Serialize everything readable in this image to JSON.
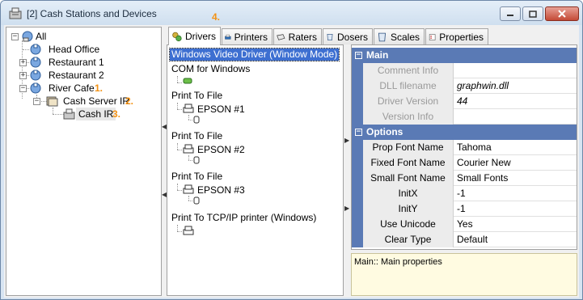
{
  "window": {
    "title": "[2] Cash Stations and Devices"
  },
  "annotations": [
    "1.",
    "2.",
    "3.",
    "4."
  ],
  "tree": {
    "root": "All",
    "items": [
      "Head Office",
      "Restaurant 1",
      "Restaurant 2",
      "River Cafe"
    ],
    "server": "Cash Server IR",
    "station": "Cash IR"
  },
  "tabs": [
    {
      "label": "Drivers",
      "icon": "drivers-icon"
    },
    {
      "label": "Printers",
      "icon": "printer-icon"
    },
    {
      "label": "Raters",
      "icon": "scale-icon"
    },
    {
      "label": "Dosers",
      "icon": "doser-icon"
    },
    {
      "label": "Scales",
      "icon": "scales-icon"
    },
    {
      "label": "Properties",
      "icon": "properties-icon"
    }
  ],
  "drivers": {
    "selected": "Windows Video Driver (Window Mode)",
    "com": "COM for Windows",
    "print_to_file": "Print To File",
    "epson1": "EPSON #1",
    "epson2": "EPSON #2",
    "epson3": "EPSON #3",
    "tcpip": "Print To TCP/IP printer (Windows)"
  },
  "properties": {
    "main_category": "Main",
    "main": [
      {
        "name": "Comment Info",
        "value": ""
      },
      {
        "name": "DLL filename",
        "value": "graphwin.dll"
      },
      {
        "name": "Driver Version",
        "value": "44"
      },
      {
        "name": "Version Info",
        "value": ""
      }
    ],
    "options_category": "Options",
    "options": [
      {
        "name": "Prop Font Name",
        "value": "Tahoma"
      },
      {
        "name": "Fixed Font Name",
        "value": "Courier New"
      },
      {
        "name": "Small Font Name",
        "value": "Small Fonts"
      },
      {
        "name": "InitX",
        "value": "-1"
      },
      {
        "name": "InitY",
        "value": "-1"
      },
      {
        "name": "Use Unicode",
        "value": "Yes"
      },
      {
        "name": "Clear Type",
        "value": "Default"
      }
    ],
    "description": "Main:: Main properties"
  },
  "colors": {
    "accent": "#f39214",
    "selection": "#3d6fd1",
    "category": "#5a7ab5"
  }
}
